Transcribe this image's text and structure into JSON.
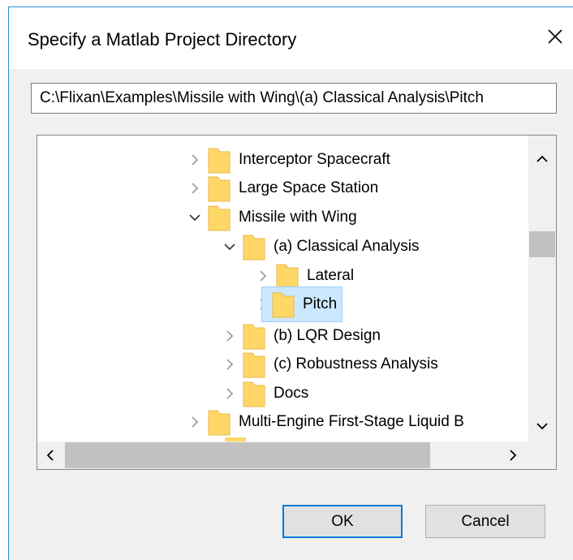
{
  "dialog": {
    "title": "Specify a Matlab Project Directory",
    "close_icon": "close-icon",
    "path_value": "C:\\Flixan\\Examples\\Missile with Wing\\(a) Classical Analysis\\Pitch",
    "ok_label": "OK",
    "cancel_label": "Cancel"
  },
  "tree": {
    "items": [
      {
        "label": "Interceptor Spacecraft",
        "expanded": false,
        "selected": false
      },
      {
        "label": "Large Space Station",
        "expanded": false,
        "selected": false
      },
      {
        "label": "Missile with Wing",
        "expanded": true,
        "selected": false
      },
      {
        "label": "(a) Classical Analysis",
        "expanded": true,
        "selected": false
      },
      {
        "label": "Lateral",
        "expanded": false,
        "selected": false
      },
      {
        "label": "Pitch",
        "expanded": false,
        "selected": true
      },
      {
        "label": "(b) LQR Design",
        "expanded": false,
        "selected": false
      },
      {
        "label": "(c) Robustness Analysis",
        "expanded": false,
        "selected": false
      },
      {
        "label": "Docs",
        "expanded": false,
        "selected": false
      },
      {
        "label": "Multi-Engine First-Stage Liquid B",
        "expanded": false,
        "selected": false
      }
    ]
  },
  "colors": {
    "accent": "#0078d7",
    "selection": "#cce8ff",
    "folder": "#ffd766"
  }
}
